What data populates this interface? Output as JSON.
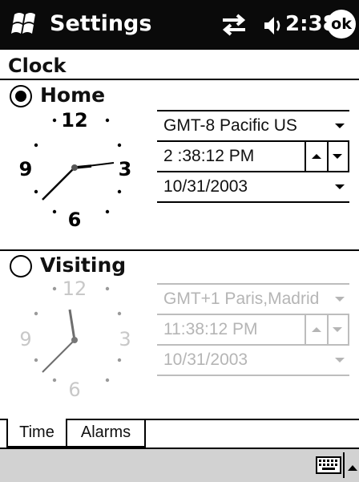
{
  "titlebar": {
    "title": "Settings",
    "time": "2:38",
    "ok_label": "ok",
    "icons": [
      "windows-start-icon",
      "connectivity-icon",
      "volume-icon"
    ]
  },
  "page": {
    "header": "Clock"
  },
  "home": {
    "label": "Home",
    "selected": true,
    "timezone": "GMT-8 Pacific US",
    "time": "2 :38:12 PM",
    "date": "10/31/2003",
    "clock": {
      "numerals": [
        "12",
        "3",
        "6",
        "9"
      ],
      "hour": 2,
      "minute": 38,
      "second": 12
    }
  },
  "visiting": {
    "label": "Visiting",
    "selected": false,
    "timezone": "GMT+1 Paris,Madrid",
    "time": "11:38:12 PM",
    "date": "10/31/2003",
    "clock": {
      "numerals": [
        "12",
        "3",
        "6",
        "9"
      ],
      "hour": 11,
      "minute": 38,
      "second": 12
    }
  },
  "tabs": [
    {
      "label": "Time",
      "active": true
    },
    {
      "label": "Alarms",
      "active": false
    }
  ],
  "colors": {
    "titlebar": "#0a0a0a",
    "dim": "#b5b5b5",
    "bottombar": "#d2d2d2"
  }
}
